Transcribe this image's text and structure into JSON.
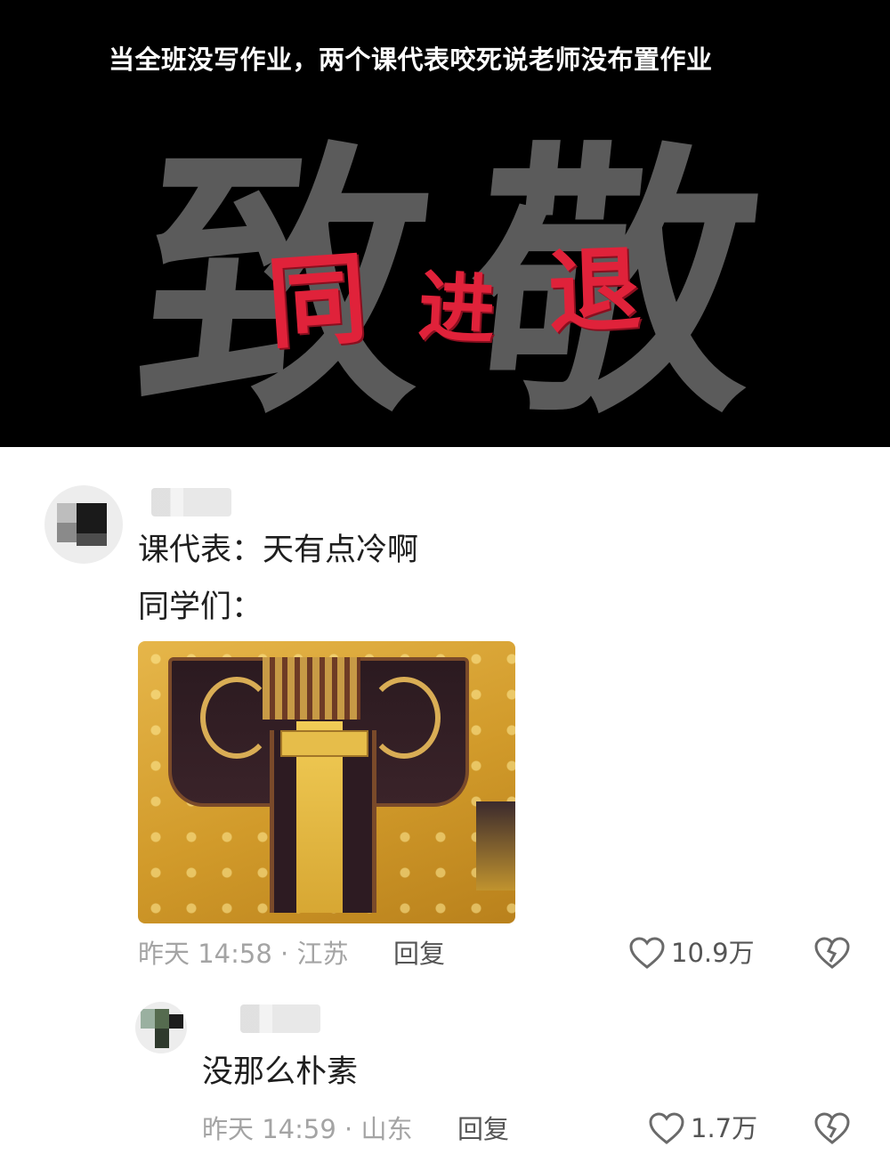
{
  "banner": {
    "caption": "当全班没写作业，两个课代表咬死说老师没布置作业",
    "big_chars": [
      "致",
      "敬"
    ],
    "red_chars": [
      "同",
      "进",
      "退"
    ]
  },
  "comments": [
    {
      "lines": [
        "课代表：天有点冷啊",
        "同学们："
      ],
      "meta": "昨天 14:58 · 江苏",
      "reply_label": "回复",
      "likes": "10.9万",
      "has_image": true
    },
    {
      "lines": [
        "没那么朴素"
      ],
      "meta": "昨天 14:59 · 山东",
      "reply_label": "回复",
      "likes": "1.7万",
      "has_image": false
    }
  ],
  "icons": {
    "like": "heart-outline-icon",
    "dislike": "broken-heart-icon"
  },
  "colors": {
    "banner_bg": "#000000",
    "big_char": "#5b5b5b",
    "red_char": "#e0223a",
    "meta_text": "#a4a4a4"
  }
}
